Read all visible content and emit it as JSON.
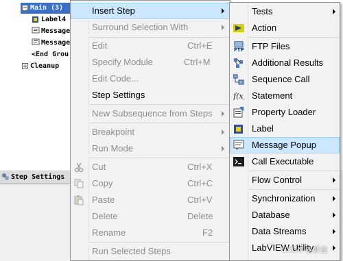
{
  "tree": {
    "main_label": "Main (3)",
    "items": [
      "Label4",
      "Message",
      "Message",
      "<End Grou"
    ],
    "cleanup_label": "Cleanup"
  },
  "step_settings_tab": "Step Settings",
  "context_menu": {
    "items": [
      {
        "label": "Insert Step",
        "shortcut": "",
        "submenu": true,
        "enabled": true
      },
      {
        "label": "Surround Selection With",
        "shortcut": "",
        "submenu": true,
        "enabled": false
      },
      {
        "label": "Edit",
        "shortcut": "Ctrl+E",
        "submenu": false,
        "enabled": false
      },
      {
        "label": "Specify Module",
        "shortcut": "Ctrl+M",
        "submenu": false,
        "enabled": false
      },
      {
        "label": "Edit Code...",
        "shortcut": "",
        "submenu": false,
        "enabled": false
      },
      {
        "label": "Step Settings",
        "shortcut": "",
        "submenu": false,
        "enabled": true
      },
      {
        "label": "New Subsequence from Steps",
        "shortcut": "",
        "submenu": true,
        "enabled": false
      },
      {
        "label": "Breakpoint",
        "shortcut": "",
        "submenu": true,
        "enabled": false
      },
      {
        "label": "Run Mode",
        "shortcut": "",
        "submenu": true,
        "enabled": false
      },
      {
        "label": "Cut",
        "shortcut": "Ctrl+X",
        "submenu": false,
        "enabled": false
      },
      {
        "label": "Copy",
        "shortcut": "Ctrl+C",
        "submenu": false,
        "enabled": false
      },
      {
        "label": "Paste",
        "shortcut": "Ctrl+V",
        "submenu": false,
        "enabled": false
      },
      {
        "label": "Delete",
        "shortcut": "Delete",
        "submenu": false,
        "enabled": false
      },
      {
        "label": "Rename",
        "shortcut": "F2",
        "submenu": false,
        "enabled": false
      },
      {
        "label": "Run Selected Steps",
        "shortcut": "",
        "submenu": false,
        "enabled": false
      }
    ]
  },
  "insert_step_submenu": {
    "items": [
      {
        "label": "Tests",
        "icon": "none",
        "submenu": true
      },
      {
        "label": "Action",
        "icon": "action-icon",
        "submenu": false
      },
      {
        "label": "FTP Files",
        "icon": "ftp-icon",
        "submenu": false
      },
      {
        "label": "Additional Results",
        "icon": "additional-results-icon",
        "submenu": false
      },
      {
        "label": "Sequence Call",
        "icon": "sequence-call-icon",
        "submenu": false
      },
      {
        "label": "Statement",
        "icon": "statement-icon",
        "submenu": false
      },
      {
        "label": "Property Loader",
        "icon": "property-loader-icon",
        "submenu": false
      },
      {
        "label": "Label",
        "icon": "label-icon",
        "submenu": false
      },
      {
        "label": "Message Popup",
        "icon": "message-popup-icon",
        "submenu": false
      },
      {
        "label": "Call Executable",
        "icon": "call-executable-icon",
        "submenu": false
      },
      {
        "label": "Flow Control",
        "icon": "none",
        "submenu": true
      },
      {
        "label": "Synchronization",
        "icon": "none",
        "submenu": true
      },
      {
        "label": "Database",
        "icon": "none",
        "submenu": true
      },
      {
        "label": "Data Streams",
        "icon": "none",
        "submenu": true
      },
      {
        "label": "LabVIEW Utility",
        "icon": "none",
        "submenu": true
      }
    ]
  },
  "watermark": "CSDN @斯金"
}
